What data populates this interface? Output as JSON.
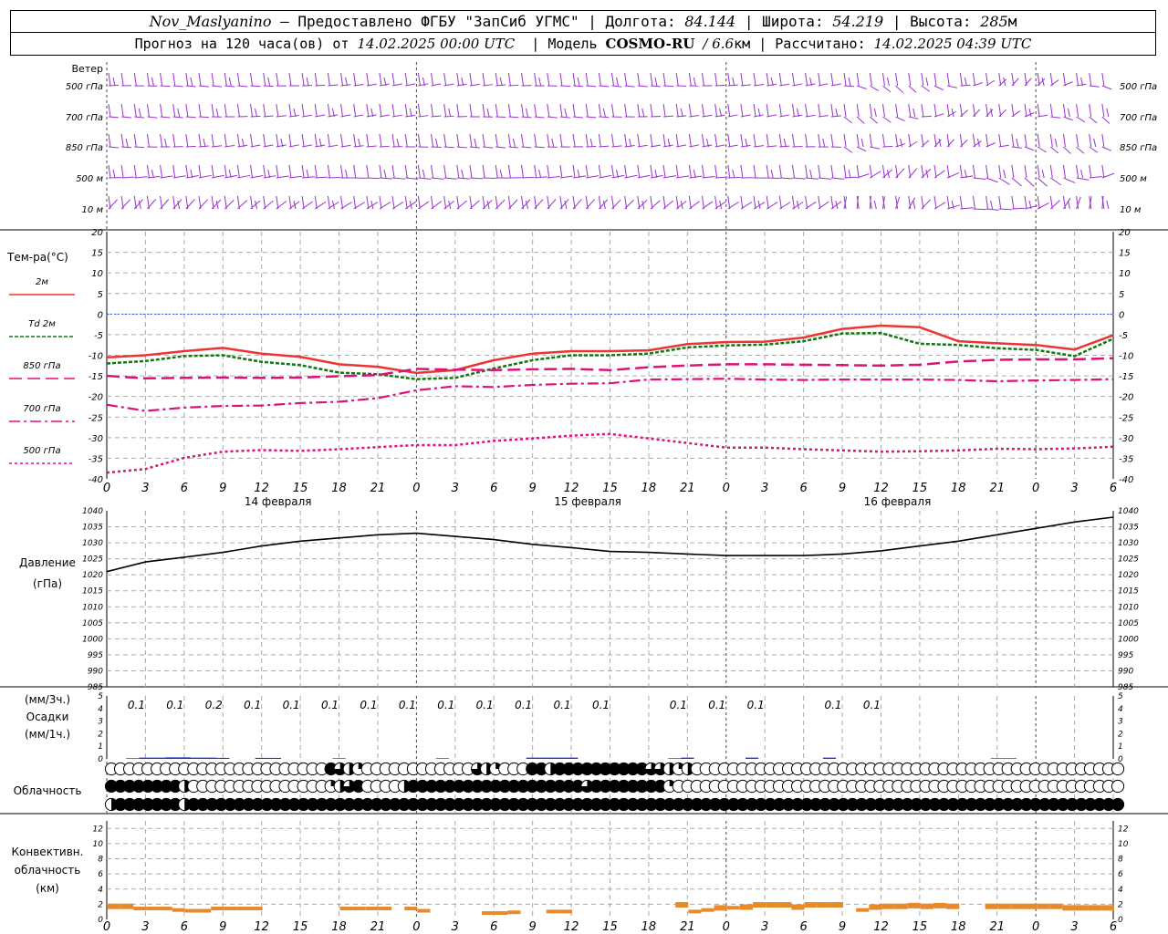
{
  "header": {
    "station": "Nov_Maslyanino",
    "provider": "— Предоставлено ФГБУ \"ЗапСиб УГМС\"",
    "lon_label": "Долгота:",
    "lon_value": "84.144",
    "lat_label": "Широта:",
    "lat_value": "54.219",
    "alt_label": "Высота:",
    "alt_value": "285",
    "alt_unit": "м",
    "forecast_prefix": "Прогноз на 120 часа(ов) от",
    "forecast_start": "14.02.2025 00:00 UTC",
    "model_label": "Модель",
    "model_name": "COSMO-RU",
    "model_res": "/ 6.6",
    "model_res_unit": "км",
    "calc_label": "Рассчитано:",
    "calc_time": "14.02.2025 04:39 UTC"
  },
  "wind_panel": {
    "title": "Ветер",
    "levels": [
      "500 гПа",
      "700 гПа",
      "850 гПа",
      "500 м",
      "10 м"
    ],
    "color": "#9933cc"
  },
  "temp_panel": {
    "title": "Тем-ра(°С)",
    "legend": [
      {
        "label": "2м",
        "color": "#ee3333",
        "dash": ""
      },
      {
        "label": "Td 2м",
        "color": "#117711",
        "dash": "4,2"
      },
      {
        "label": "850 гПа",
        "color": "#dd1177",
        "dash": "14,6"
      },
      {
        "label": "700 гПа",
        "color": "#dd1177",
        "dash": "12,4,3,4"
      },
      {
        "label": "500 гПа",
        "color": "#dd1177",
        "dash": "3,3"
      }
    ],
    "yticks": [
      20,
      15,
      10,
      5,
      0,
      -5,
      -10,
      -15,
      -20,
      -25,
      -30,
      -35,
      -40
    ]
  },
  "time_axis": {
    "hour_labels": [
      "0",
      "3",
      "6",
      "9",
      "12",
      "15",
      "18",
      "21",
      "0",
      "3",
      "6",
      "9",
      "12",
      "15",
      "18",
      "21",
      "0",
      "3",
      "6",
      "9",
      "12",
      "15",
      "18",
      "21",
      "0",
      "3",
      "6"
    ],
    "day_labels": [
      "14 февраля",
      "15 февраля",
      "16 февраля"
    ]
  },
  "pressure_panel": {
    "title": "Давление",
    "unit": "(гПа)",
    "yticks": [
      1040,
      1035,
      1030,
      1025,
      1020,
      1015,
      1010,
      1005,
      1000,
      995,
      990,
      985
    ]
  },
  "precip_panel": {
    "unit_3h": "(мм/3ч.)",
    "title": "Осадки",
    "unit_1h": "(мм/1ч.)",
    "yticks": [
      5,
      4,
      3,
      2,
      1,
      0
    ],
    "labels_3h": [
      {
        "hour": 3,
        "text": "0.1"
      },
      {
        "hour": 6,
        "text": "0.1"
      },
      {
        "hour": 9,
        "text": "0.2"
      },
      {
        "hour": 12,
        "text": "0.1"
      },
      {
        "hour": 15,
        "text": "0.1"
      },
      {
        "hour": 18,
        "text": "0.1"
      },
      {
        "hour": 21,
        "text": "0.1"
      },
      {
        "hour": 24,
        "text": "0.1"
      },
      {
        "hour": 27,
        "text": "0.1"
      },
      {
        "hour": 30,
        "text": "0.1"
      },
      {
        "hour": 33,
        "text": "0.1"
      },
      {
        "hour": 36,
        "text": "0.1"
      },
      {
        "hour": 39,
        "text": "0.1"
      },
      {
        "hour": 45,
        "text": "0.1"
      },
      {
        "hour": 48,
        "text": "0.1"
      },
      {
        "hour": 51,
        "text": "0.1"
      },
      {
        "hour": 57,
        "text": "0.1"
      },
      {
        "hour": 60,
        "text": "0.1"
      }
    ]
  },
  "cloud_panel": {
    "title": "Облачность"
  },
  "conv_panel": {
    "title_lines": [
      "Конвективн.",
      "облачность",
      "(км)"
    ],
    "yticks": [
      12,
      10,
      8,
      6,
      4,
      2,
      0
    ],
    "color": "#e88a2a"
  },
  "chart_data": [
    {
      "type": "line",
      "title": "Тем-ра(°С)",
      "x_unit": "hours since 14.02.2025 00:00 UTC",
      "x": [
        0,
        3,
        6,
        9,
        12,
        15,
        18,
        21,
        24,
        27,
        30,
        33,
        36,
        39,
        42,
        45,
        48,
        51,
        54,
        57,
        60,
        63,
        66,
        69,
        72,
        75,
        78
      ],
      "ylim": [
        -40,
        20
      ],
      "series": [
        {
          "name": "2м",
          "values": [
            -10.5,
            -10,
            -9,
            -8.2,
            -9.6,
            -10.4,
            -12.2,
            -12.8,
            -14.3,
            -13.6,
            -11.2,
            -9.6,
            -9,
            -9,
            -8.8,
            -7.3,
            -6.8,
            -6.7,
            -5.7,
            -3.6,
            -2.8,
            -3.2,
            -6.6,
            -7.1,
            -7.5,
            -8.6,
            -5.1
          ]
        },
        {
          "name": "Td 2м",
          "values": [
            -12,
            -11.4,
            -10.2,
            -10,
            -11.6,
            -12.4,
            -14.2,
            -14.6,
            -15.8,
            -15.5,
            -13.2,
            -11.2,
            -10,
            -10,
            -9.6,
            -8.1,
            -7.6,
            -7.4,
            -6.6,
            -4.7,
            -4.6,
            -7.2,
            -7.5,
            -8.3,
            -8.7,
            -10.2,
            -6
          ]
        },
        {
          "name": "850 гПа",
          "values": [
            -15,
            -15.6,
            -15.5,
            -15.4,
            -15.5,
            -15.4,
            -15.1,
            -14.8,
            -13.3,
            -13.5,
            -13.6,
            -13.4,
            -13.3,
            -13.6,
            -12.9,
            -12.5,
            -12.2,
            -12.2,
            -12.3,
            -12.4,
            -12.5,
            -12.3,
            -11.5,
            -11.1,
            -11,
            -11,
            -10.7
          ]
        },
        {
          "name": "700 гПа",
          "values": [
            -22,
            -23.5,
            -22.7,
            -22.3,
            -22.2,
            -21.6,
            -21.3,
            -20.4,
            -18.5,
            -17.5,
            -17.7,
            -17.2,
            -16.9,
            -16.8,
            -15.9,
            -15.8,
            -15.7,
            -15.9,
            -16,
            -15.9,
            -15.9,
            -15.9,
            -16,
            -16.3,
            -16.1,
            -16,
            -15.8
          ]
        },
        {
          "name": "500 гПа",
          "values": [
            -38.5,
            -37.6,
            -34.9,
            -33.4,
            -33,
            -33.2,
            -32.8,
            -32.3,
            -31.8,
            -31.8,
            -30.8,
            -30.2,
            -29.5,
            -29.1,
            -30.2,
            -31.3,
            -32.4,
            -32.4,
            -32.8,
            -33.1,
            -33.4,
            -33.3,
            -33.1,
            -32.7,
            -32.8,
            -32.6,
            -32.2
          ]
        }
      ]
    },
    {
      "type": "line",
      "title": "Давление",
      "ylabel": "(гПа)",
      "x_unit": "hours since 14.02.2025 00:00 UTC",
      "x": [
        0,
        3,
        6,
        9,
        12,
        15,
        18,
        21,
        24,
        27,
        30,
        33,
        36,
        39,
        42,
        45,
        48,
        51,
        54,
        57,
        60,
        63,
        66,
        69,
        72,
        75,
        78
      ],
      "ylim": [
        985,
        1040
      ],
      "series": [
        {
          "name": "",
          "values": [
            1021,
            1024,
            1025.5,
            1027,
            1029,
            1030.5,
            1031.5,
            1032.5,
            1033,
            1032,
            1031,
            1029.5,
            1028.5,
            1027.3,
            1027,
            1026.5,
            1026,
            1026,
            1026,
            1026.5,
            1027.5,
            1029,
            1030.5,
            1032.5,
            1034.5,
            1036.5,
            1038
          ]
        }
      ]
    },
    {
      "type": "bar",
      "title": "Осадки",
      "ylabel": "(мм/1ч.)",
      "x_unit": "hours since 14.02.2025 00:00 UTC",
      "ylim": [
        0,
        5
      ],
      "series": [
        {
          "name": "",
          "x": [
            2,
            3,
            4,
            5,
            6,
            7,
            8,
            9,
            12,
            13,
            18,
            26,
            33,
            34,
            35,
            36,
            44,
            45,
            50,
            56,
            69,
            70
          ],
          "values": [
            0.05,
            0.1,
            0.1,
            0.12,
            0.12,
            0.1,
            0.1,
            0.08,
            0.08,
            0.08,
            0.05,
            0.05,
            0.1,
            0.1,
            0.1,
            0.1,
            0.05,
            0.1,
            0.1,
            0.1,
            0.05,
            0.05
          ]
        }
      ]
    },
    {
      "type": "bar",
      "title": "Конвективн. облачность (км)",
      "x_unit": "hours since 14.02.2025 00:00 UTC",
      "ylim": [
        0,
        13
      ],
      "series": [
        {
          "name": "",
          "x": [
            0,
            1,
            2,
            3,
            4,
            5,
            6,
            7,
            8,
            9,
            10,
            11,
            18,
            19,
            20,
            21,
            23,
            24,
            29,
            30,
            31,
            34,
            35,
            44,
            45,
            46,
            47,
            48,
            49,
            50,
            51,
            52,
            53,
            54,
            55,
            56,
            58,
            59,
            60,
            61,
            62,
            63,
            64,
            65,
            68,
            69,
            70,
            71,
            72,
            73,
            74,
            75,
            76,
            77
          ],
          "values": [
            1.6,
            1.6,
            1.2,
            1.2,
            1.2,
            1.0,
            0.9,
            0.9,
            1.2,
            1.2,
            1.2,
            1.2,
            1.2,
            1.2,
            1.2,
            1.2,
            1.2,
            0.9,
            0.6,
            0.6,
            0.7,
            0.8,
            0.8,
            1.8,
            0.8,
            1.0,
            1.4,
            1.3,
            1.5,
            1.8,
            1.8,
            1.8,
            1.5,
            1.8,
            1.8,
            1.8,
            1.0,
            1.5,
            1.6,
            1.6,
            1.7,
            1.6,
            1.7,
            1.6,
            1.6,
            1.6,
            1.6,
            1.6,
            1.6,
            1.6,
            1.4,
            1.4,
            1.4,
            1.4
          ]
        }
      ]
    },
    {
      "type": "table",
      "title": "Облачность",
      "rows": [
        {
          "name": "upper",
          "x_unit": "index of 3-hourly columns",
          "values": [
            0,
            0,
            0,
            0,
            0,
            0,
            0,
            0,
            0,
            0,
            0,
            0,
            0,
            0,
            0,
            0,
            0,
            0,
            0,
            0,
            0,
            0,
            0,
            0,
            4,
            3,
            2,
            1,
            0,
            0,
            0,
            0,
            0,
            0,
            0,
            0,
            0,
            0,
            0,
            0,
            3,
            2,
            1,
            0,
            0,
            0,
            4,
            4,
            2,
            4,
            4,
            4,
            4,
            4,
            4,
            4,
            4,
            4,
            4,
            3,
            3,
            2,
            1,
            2,
            0,
            0,
            0,
            0,
            0,
            0,
            0,
            0,
            0,
            0,
            0,
            0,
            0,
            0,
            0,
            0,
            0,
            0,
            0,
            0,
            0,
            0,
            0,
            0,
            0,
            0,
            0,
            0,
            0,
            0,
            0,
            0,
            0,
            0,
            0,
            0,
            0,
            0,
            0,
            0,
            0,
            0,
            0,
            0,
            0,
            0,
            0
          ]
        },
        {
          "name": "middle",
          "x_unit": "index of 3-hourly columns",
          "values": [
            4,
            4,
            4,
            4,
            4,
            4,
            4,
            4,
            2,
            0,
            0,
            0,
            0,
            0,
            0,
            0,
            0,
            0,
            0,
            0,
            0,
            0,
            0,
            0,
            1,
            2,
            3,
            4,
            0,
            0,
            0,
            0,
            2,
            4,
            4,
            4,
            4,
            4,
            4,
            4,
            4,
            4,
            4,
            4,
            4,
            4,
            4,
            4,
            4,
            4,
            4,
            4,
            3,
            4,
            4,
            4,
            4,
            4,
            4,
            4,
            4,
            1,
            0,
            0,
            0,
            0,
            0,
            0,
            0,
            0,
            0,
            0,
            0,
            0,
            0,
            0,
            0,
            0,
            0,
            0,
            0,
            0,
            0,
            0,
            0,
            0,
            0,
            0,
            0,
            0,
            0,
            0,
            0,
            0,
            0,
            0,
            0,
            0,
            0,
            0,
            0,
            0,
            0,
            0,
            0,
            0,
            0,
            0,
            0,
            0,
            0
          ]
        },
        {
          "name": "lower",
          "x_unit": "index of 3-hourly columns",
          "values": [
            2,
            4,
            4,
            4,
            4,
            4,
            4,
            4,
            2,
            4,
            4,
            4,
            4,
            4,
            4,
            4,
            4,
            4,
            4,
            4,
            4,
            4,
            4,
            4,
            4,
            4,
            4,
            4,
            4,
            4,
            4,
            4,
            4,
            4,
            4,
            4,
            4,
            4,
            4,
            4,
            4,
            4,
            4,
            4,
            4,
            4,
            4,
            4,
            4,
            4,
            4,
            4,
            4,
            4,
            4,
            4,
            4,
            4,
            4,
            4,
            4,
            4,
            4,
            4,
            4,
            4,
            4,
            4,
            4,
            4,
            4,
            4,
            4,
            4,
            4,
            4,
            4,
            4,
            4,
            4,
            4,
            4,
            4,
            4,
            4,
            4,
            4,
            4,
            4,
            4,
            4,
            4,
            4,
            4,
            4,
            4,
            4,
            4,
            4,
            4,
            4,
            4,
            4,
            4,
            4,
            4,
            4,
            4,
            4,
            4,
            4
          ]
        }
      ]
    }
  ]
}
